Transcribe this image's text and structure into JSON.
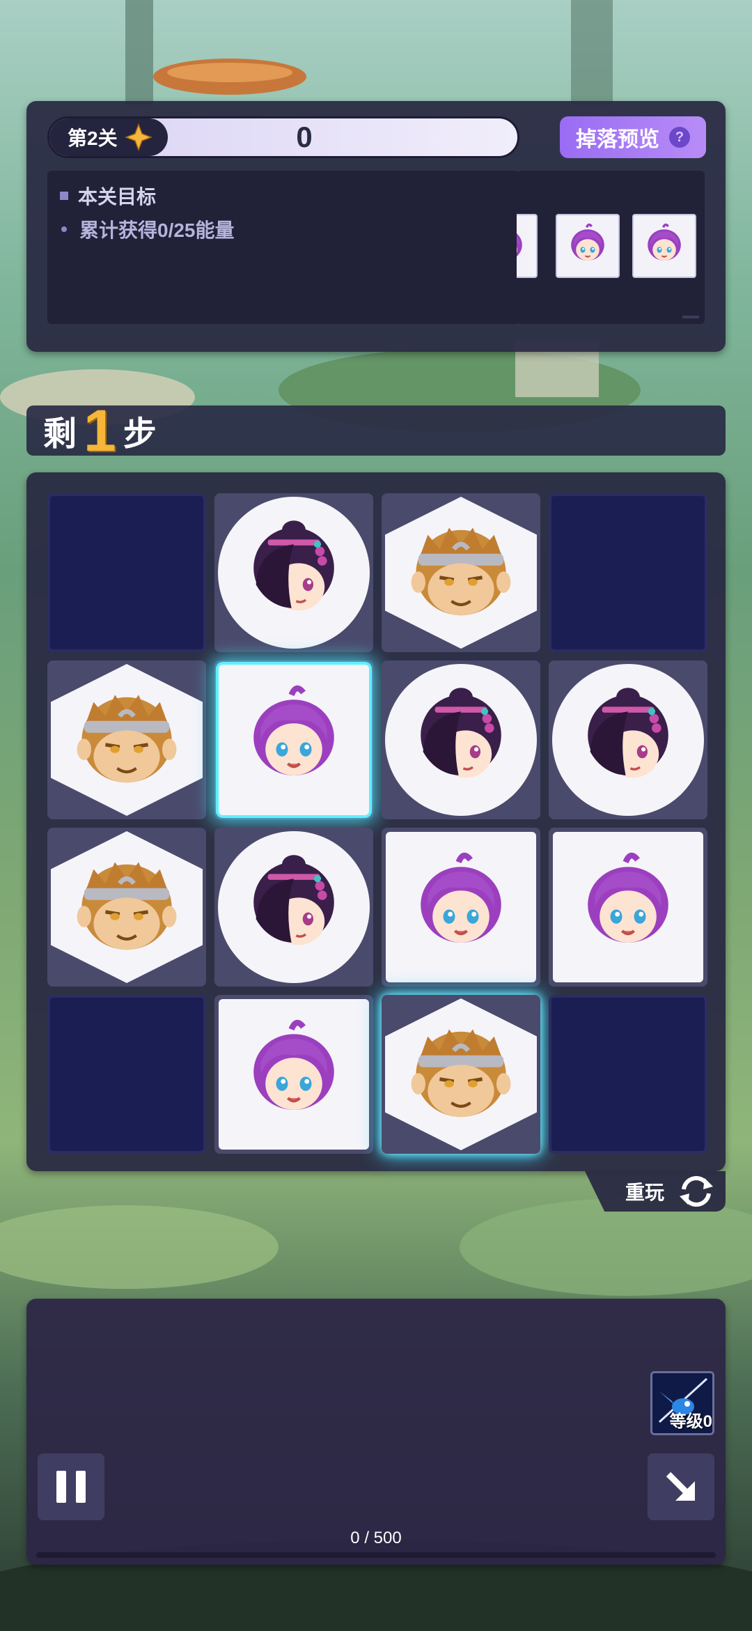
{
  "level": {
    "label": "第2关",
    "star_icon": "star-icon",
    "score": "0"
  },
  "drop_preview": {
    "label": "掉落预览",
    "help_icon": "help-icon",
    "items": [
      "purple-hair-girl-icon",
      "purple-hair-girl-icon",
      "purple-hair-girl-icon"
    ]
  },
  "goal": {
    "title": "本关目标",
    "items": [
      "累计获得0/25能量"
    ]
  },
  "steps": {
    "prefix": "剩",
    "count": "1",
    "suffix": "步"
  },
  "grid": {
    "rows": 4,
    "cols": 4,
    "cells": [
      [
        "empty",
        "dark-hair-girl",
        "monkey-king",
        "empty"
      ],
      [
        "monkey-king",
        "purple-hair-girl",
        "dark-hair-girl",
        "dark-hair-girl"
      ],
      [
        "monkey-king",
        "dark-hair-girl",
        "purple-hair-girl",
        "purple-hair-girl"
      ],
      [
        "empty",
        "purple-hair-girl",
        "monkey-king",
        "empty"
      ]
    ],
    "selected": [
      [
        1,
        1
      ],
      [
        3,
        2
      ]
    ]
  },
  "replay": {
    "label": "重玩",
    "icon": "refresh-icon"
  },
  "bottom": {
    "pause_icon": "pause-icon",
    "skip_icon": "arrow-down-right-icon",
    "skill": {
      "icon": "skill-bird-icon",
      "level_label": "等级0"
    },
    "progress": {
      "current": 0,
      "max": 500,
      "label": "0 / 500"
    }
  },
  "colors": {
    "accent_purple": "#9a6cf3",
    "steps_gold": "#f7b638",
    "glow_cyan": "#5ff0ff",
    "panel": "#282842"
  }
}
